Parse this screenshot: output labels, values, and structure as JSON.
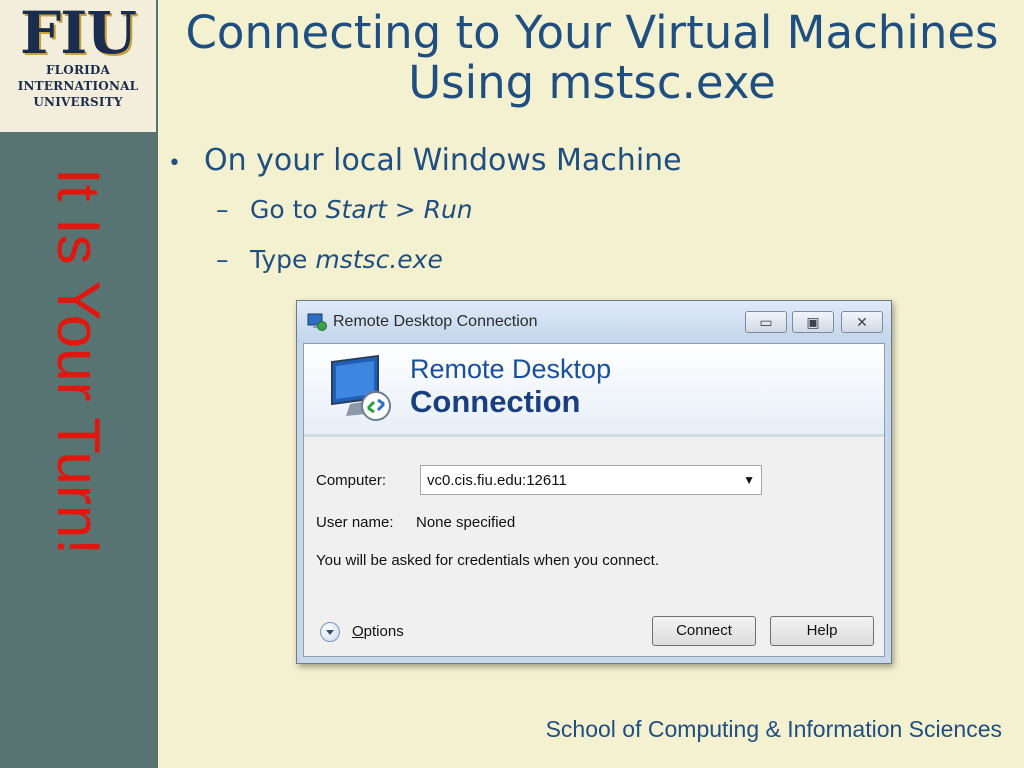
{
  "logo": {
    "mark": "FIU",
    "line1": "FLORIDA",
    "line2": "INTERNATIONAL",
    "line3": "UNIVERSITY"
  },
  "sidebar": {
    "vertical_text": "It Is Your Turn!"
  },
  "slide": {
    "title_line1": "Connecting to Your Virtual Machines",
    "title_line2": "Using mstsc.exe",
    "bullet1": "On your local Windows Machine",
    "sub1_prefix": "Go to ",
    "sub1_em": "Start > Run",
    "sub2_prefix": "Type ",
    "sub2_em": "mstsc.exe",
    "footer": "School of Computing & Information Sciences"
  },
  "window": {
    "title": "Remote Desktop Connection",
    "banner_line1": "Remote Desktop",
    "banner_line2": "Connection",
    "computer_label": "Computer:",
    "computer_value": "vc0.cis.fiu.edu:12611",
    "username_label": "User name:",
    "username_value": "None specified",
    "info_text": "You will be asked for credentials when you connect.",
    "options_first": "O",
    "options_rest": "ptions",
    "connect_label": "Connect",
    "help_label": "Help"
  },
  "colors": {
    "title_blue": "#1f4e80",
    "sidebar_teal": "#587472",
    "turn_red": "#e0170f",
    "slide_bg": "#f4f1d0"
  },
  "icons": {
    "app": "remote-desktop-icon",
    "banner": "monitor-icon",
    "options": "chevron-down-circle-icon"
  }
}
